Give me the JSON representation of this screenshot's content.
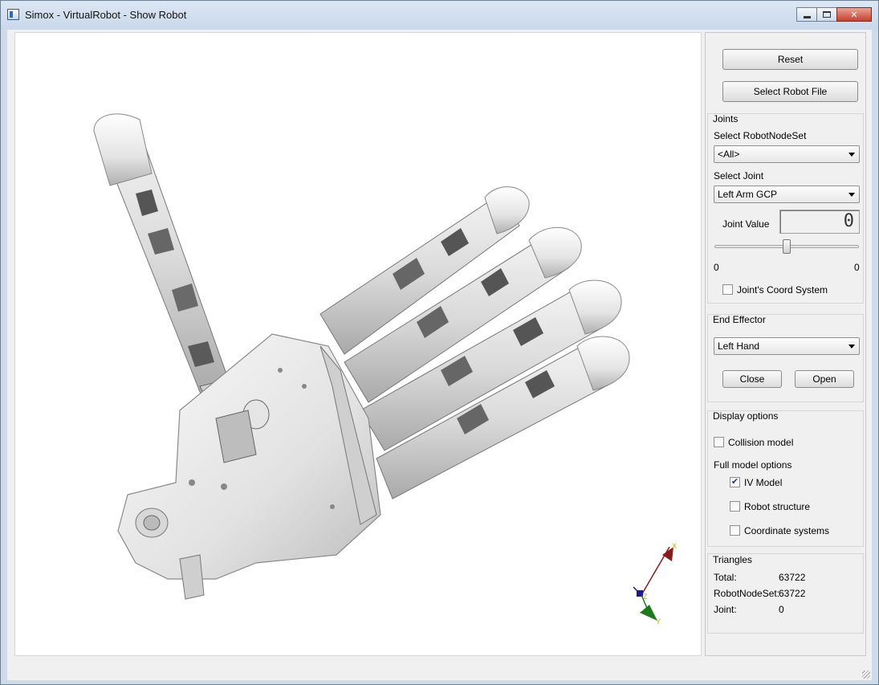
{
  "window": {
    "title": "Simox - VirtualRobot - Show Robot",
    "icon": "app-icon",
    "controls": {
      "minimize": "minimize-icon",
      "maximize": "maximize-icon",
      "close": "close-icon",
      "close_glyph": "✕"
    }
  },
  "viewer": {
    "axes": {
      "x_label": "X",
      "y_label": "Y",
      "z_label": "Z",
      "x_color": "#8b1a1a",
      "y_color": "#1f7a1f",
      "z_color": "#1a1a8b"
    }
  },
  "panel": {
    "reset_label": "Reset",
    "select_robot_file_label": "Select Robot File",
    "joints": {
      "title": "Joints",
      "select_nodeset_label": "Select RobotNodeSet",
      "nodeset_value": "<All>",
      "select_joint_label": "Select Joint",
      "joint_value_selected": "Left Arm GCP",
      "joint_value_label": "Joint Value",
      "joint_value_display": "0",
      "slider_min": "0",
      "slider_max": "0",
      "slider_position": 0.5,
      "coord_system_label": "Joint's Coord System",
      "coord_system_checked": false
    },
    "end_effector": {
      "title": "End Effector",
      "selected": "Left Hand",
      "close_label": "Close",
      "open_label": "Open"
    },
    "display": {
      "title": "Display options",
      "collision_label": "Collision model",
      "collision_checked": false,
      "full_model_label": "Full model options",
      "iv_model_label": "IV Model",
      "iv_model_checked": true,
      "robot_structure_label": "Robot structure",
      "robot_structure_checked": false,
      "coord_systems_label": "Coordinate systems",
      "coord_systems_checked": false
    },
    "triangles": {
      "title": "Triangles",
      "total_label": "Total:",
      "total_value": "63722",
      "nodeset_label": "RobotNodeSet:",
      "nodeset_value": "63722",
      "joint_label": "Joint:",
      "joint_value": "0"
    }
  }
}
